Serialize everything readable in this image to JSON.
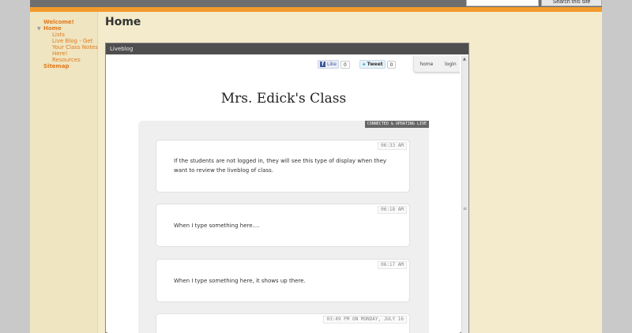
{
  "site": {
    "search_button": "Search this site"
  },
  "nav": {
    "welcome": "Welcome!",
    "home": "Home",
    "items": [
      "Lists",
      "Live Blog - Get Your Class Notes Here!",
      "Resources"
    ],
    "sitemap": "Sitemap"
  },
  "page_title": "Home",
  "panel": {
    "title": "Liveblog"
  },
  "social": {
    "like_label": "Like",
    "like_count": "0",
    "tweet_label": "Tweet",
    "tweet_count": "0"
  },
  "mini_nav": {
    "home": "home",
    "login": "login"
  },
  "blog": {
    "title": "Mrs. Edick's Class",
    "status": "CONNECTED & UPDATING LIVE",
    "entries": [
      {
        "time": "06:33 AM",
        "text": "If the students are not logged in, they will see this type of display when they want to review the liveblog of class."
      },
      {
        "time": "06:18 AM",
        "text": "When I type something here...."
      },
      {
        "time": "06:17 AM",
        "text": "When I type something here, it shows up there."
      },
      {
        "time": "03:49 PM ON MONDAY, JULY 16",
        "text": ""
      }
    ]
  }
}
